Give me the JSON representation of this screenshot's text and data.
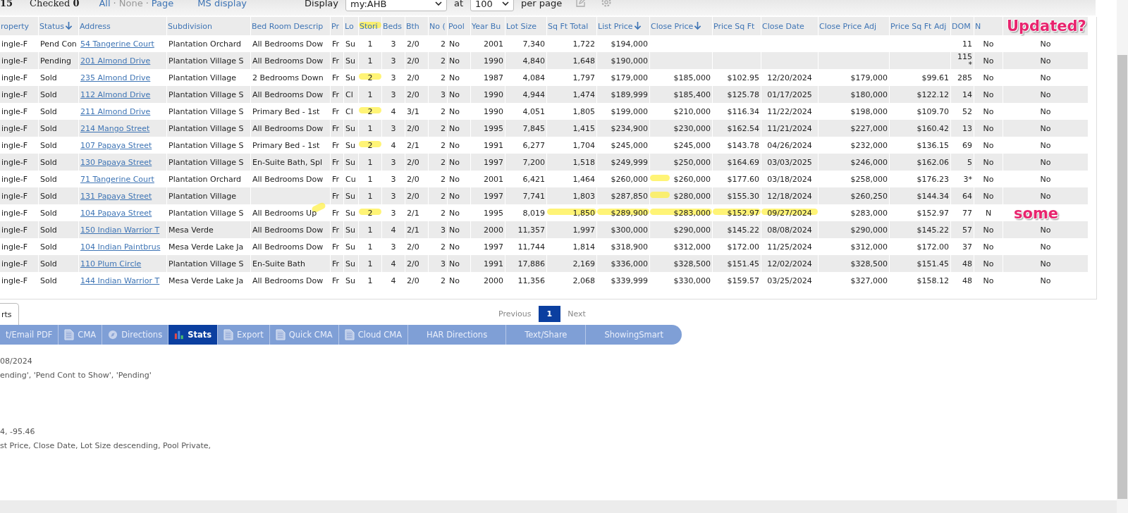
{
  "topbar": {
    "count": "15",
    "checked": "Checked **0**",
    "select_links": [
      {
        "label": "All",
        "kind": "link",
        "disabled": false
      },
      {
        "label": "·",
        "kind": "separator"
      },
      {
        "label": "None",
        "kind": "link",
        "disabled": true
      },
      {
        "label": "·",
        "kind": "separator"
      },
      {
        "label": "Page",
        "kind": "link",
        "disabled": false
      }
    ],
    "ms_display": "MS display",
    "display_label": "Display",
    "display_value": "my:AHB",
    "at_label": "at",
    "per_page_value": "100",
    "per_page_label": "per page"
  },
  "columns": [
    {
      "label": "roperty",
      "sorted": false
    },
    {
      "label": "Status",
      "sorted": true
    },
    {
      "label": "Address",
      "sorted": false,
      "kind": "link"
    },
    {
      "label": "Subdivision",
      "sorted": false
    },
    {
      "label": "Bed Room Descrip",
      "sorted": false
    },
    {
      "label": "Pr",
      "sorted": false
    },
    {
      "label": "Lo",
      "sorted": false
    },
    {
      "label": "Stori",
      "sorted": false,
      "highlighted": true
    },
    {
      "label": "Beds",
      "sorted": false
    },
    {
      "label": "Bth",
      "sorted": false
    },
    {
      "label": "No (",
      "sorted": false
    },
    {
      "label": "Pool",
      "sorted": false
    },
    {
      "label": "Year Bu",
      "sorted": false
    },
    {
      "label": "Lot Size",
      "sorted": false
    },
    {
      "label": "Sq Ft Total",
      "sorted": false
    },
    {
      "label": "List Price",
      "sorted": true
    },
    {
      "label": "Close Price",
      "sorted": true
    },
    {
      "label": "Price Sq Ft",
      "sorted": false
    },
    {
      "label": "Close Date",
      "sorted": false
    },
    {
      "label": "Close Price Adj",
      "sorted": false
    },
    {
      "label": "Price Sq Ft Adj",
      "sorted": false
    },
    {
      "label": "DOM",
      "sorted": false
    },
    {
      "label": "N",
      "sorted": false
    }
  ],
  "rows": [
    {
      "kind": "plain",
      "cells": [
        "ingle-F",
        "Pend Con",
        "54 Tangerine Court",
        "Plantation Orchard",
        "All Bedrooms Dow",
        "Fr",
        "Su",
        "1",
        "3",
        "2/0",
        "2",
        "No",
        "2001",
        "7,340",
        "1,722",
        "$194,000",
        null,
        null,
        null,
        null,
        null,
        "11",
        "No",
        "No"
      ]
    },
    {
      "kind": "plain",
      "cells": [
        "ingle-F",
        "Pending",
        "201 Almond Drive",
        "Plantation Village S",
        "All Bedrooms Dow",
        "Fr",
        "Su",
        "1",
        "3",
        "2/0",
        "2",
        "No",
        "1990",
        "4,840",
        "1,648",
        "$190,000",
        null,
        null,
        null,
        null,
        null,
        "115\n*",
        "No",
        "No"
      ]
    },
    {
      "kind": "stories-marked",
      "cells": [
        "ingle-F",
        "Sold",
        "235 Almond Drive",
        "Plantation Village",
        "2 Bedrooms Down",
        "Fr",
        "Su",
        "2",
        "3",
        "2/0",
        "2",
        "No",
        "1987",
        "4,084",
        "1,797",
        "$179,000",
        "$185,000",
        "$102.95",
        "12/20/2024",
        "$179,000",
        "$99.61",
        "285",
        "No",
        "No"
      ]
    },
    {
      "kind": "plain",
      "cells": [
        "ingle-F",
        "Sold",
        "112 Almond Drive",
        "Plantation Village S",
        "All Bedrooms Dow",
        "Fr",
        "Cl",
        "1",
        "3",
        "2/0",
        "3",
        "No",
        "1990",
        "4,944",
        "1,474",
        "$189,999",
        "$185,400",
        "$125.78",
        "01/17/2025",
        "$180,000",
        "$122.12",
        "14",
        "No",
        "No"
      ]
    },
    {
      "kind": "stories-marked",
      "cells": [
        "ingle-F",
        "Sold",
        "211 Almond Drive",
        "Plantation Village S",
        "Primary Bed - 1st",
        "Fr",
        "Cl",
        "2",
        "4",
        "3/1",
        "2",
        "No",
        "1990",
        "4,051",
        "1,805",
        "$199,000",
        "$210,000",
        "$116.34",
        "11/22/2024",
        "$198,000",
        "$109.70",
        "52",
        "No",
        "No"
      ]
    },
    {
      "kind": "plain",
      "cells": [
        "ingle-F",
        "Sold",
        "214 Mango Street",
        "Plantation Village S",
        "All Bedrooms Dow",
        "Fr",
        "Su",
        "1",
        "3",
        "2/0",
        "2",
        "No",
        "1995",
        "7,845",
        "1,415",
        "$234,900",
        "$230,000",
        "$162.54",
        "11/21/2024",
        "$227,000",
        "$160.42",
        "13",
        "No",
        "No"
      ]
    },
    {
      "kind": "stories-marked",
      "cells": [
        "ingle-F",
        "Sold",
        "107 Papaya Street",
        "Plantation Village S",
        "Primary Bed - 1st",
        "Fr",
        "Su",
        "2",
        "4",
        "2/1",
        "2",
        "No",
        "1991",
        "6,277",
        "1,704",
        "$245,000",
        "$245,000",
        "$143.78",
        "04/26/2024",
        "$232,000",
        "$136.15",
        "69",
        "No",
        "No"
      ]
    },
    {
      "kind": "plain",
      "cells": [
        "ingle-F",
        "Sold",
        "130 Papaya Street",
        "Plantation Village S",
        "En-Suite Bath, Spl",
        "Fr",
        "Su",
        "1",
        "3",
        "2/0",
        "2",
        "No",
        "1997",
        "7,200",
        "1,518",
        "$249,999",
        "$250,000",
        "$164.69",
        "03/03/2025",
        "$246,000",
        "$162.06",
        "5",
        "No",
        "No"
      ]
    },
    {
      "kind": "close-price-marked",
      "cells": [
        "ingle-F",
        "Sold",
        "71 Tangerine Court",
        "Plantation Orchard",
        "All Bedrooms Dow",
        "Fr",
        "Cu",
        "1",
        "3",
        "2/0",
        "2",
        "No",
        "2001",
        "6,421",
        "1,464",
        "$260,000",
        "$260,000",
        "$177.60",
        "03/18/2024",
        "$258,000",
        "$176.23",
        "3*",
        "No",
        "No"
      ]
    },
    {
      "kind": "close-price-marked",
      "cells": [
        "ingle-F",
        "Sold",
        "131 Papaya Street",
        "Plantation Village",
        null,
        "Fr",
        "Su",
        "1",
        "3",
        "2/0",
        "2",
        "No",
        "1997",
        "7,741",
        "1,803",
        "$287,850",
        "$280,000",
        "$155.30",
        "12/18/2024",
        "$260,250",
        "$144.34",
        "64",
        "No",
        "No"
      ]
    },
    {
      "kind": "line-marked",
      "cells": [
        "ingle-F",
        "Sold",
        "104 Papaya Street",
        "Plantation Village S",
        "All Bedrooms Up",
        "Fr",
        "Su",
        "2",
        "3",
        "2/1",
        "2",
        "No",
        "1995",
        "8,019",
        "1,850",
        "$289,900",
        "$283,000",
        "$152.97",
        "09/27/2024",
        "$283,000",
        "$152.97",
        "77",
        "N"
      ]
    },
    {
      "kind": "plain",
      "cells": [
        "ingle-F",
        "Sold",
        "150 Indian Warrior T",
        "Mesa Verde",
        "All Bedrooms Dow",
        "Fr",
        "Su",
        "1",
        "4",
        "2/1",
        "3",
        "No",
        "2000",
        "11,357",
        "1,997",
        "$300,000",
        "$290,000",
        "$145.22",
        "08/08/2024",
        "$290,000",
        "$145.22",
        "57",
        "No",
        "No"
      ]
    },
    {
      "kind": "plain",
      "cells": [
        "ingle-F",
        "Sold",
        "104 Indian Paintbrus",
        "Mesa Verde Lake Ja",
        "All Bedrooms Dow",
        "Fr",
        "Su",
        "1",
        "3",
        "2/0",
        "2",
        "No",
        "1997",
        "11,744",
        "1,814",
        "$318,900",
        "$312,000",
        "$172.00",
        "11/25/2024",
        "$312,000",
        "$172.00",
        "37",
        "No",
        "No"
      ]
    },
    {
      "kind": "plain",
      "cells": [
        "ingle-F",
        "Sold",
        "110 Plum Circle",
        "Plantation Village S",
        "En-Suite Bath",
        "Fr",
        "Su",
        "1",
        "4",
        "2/0",
        "3",
        "No",
        "1991",
        "17,886",
        "2,169",
        "$336,000",
        "$328,500",
        "$151.45",
        "12/02/2024",
        "$328,500",
        "$151.45",
        "48",
        "No",
        "No"
      ]
    },
    {
      "kind": "plain",
      "cells": [
        "ingle-F",
        "Sold",
        "144 Indian Warrior T",
        "Mesa Verde Lake Ja",
        "All Bedrooms Dow",
        "Fr",
        "Su",
        "1",
        "4",
        "2/0",
        "2",
        "No",
        "2000",
        "11,356",
        "2,068",
        "$339,999",
        "$330,000",
        "$159.57",
        "03/25/2024",
        "$327,000",
        "$158.12",
        "48",
        "No",
        "No"
      ]
    }
  ],
  "annotations": [
    {
      "text": "Updated?"
    },
    {
      "text": "some"
    }
  ],
  "tab": {
    "label": "rts",
    "selected": true
  },
  "pagination": {
    "previous": "Previous",
    "pages": [
      {
        "label": "1",
        "selected": true
      }
    ],
    "next": "Next"
  },
  "toolbar": [
    {
      "label": "t/Email PDF",
      "kind": "plain",
      "selected": false
    },
    {
      "label": "CMA",
      "kind": "document",
      "selected": false
    },
    {
      "label": "Directions",
      "kind": "compass",
      "selected": false
    },
    {
      "label": "Stats",
      "kind": "chart",
      "selected": true
    },
    {
      "label": "Export",
      "kind": "document",
      "selected": false
    },
    {
      "label": "Quick CMA",
      "kind": "document",
      "selected": false
    },
    {
      "label": "Cloud CMA",
      "kind": "document",
      "selected": false
    },
    {
      "label": "HAR Directions",
      "kind": "plain",
      "selected": false
    },
    {
      "label": "Text/Share",
      "kind": "plain",
      "selected": false
    },
    {
      "label": "ShowingSmart",
      "kind": "plain",
      "selected": false
    }
  ],
  "info_lines": [
    "08/2024",
    "ending', 'Pend Cont to Show', 'Pending'",
    "4, -95.46",
    "st Price, Close Date, Lot Size descending, Pool Private,"
  ]
}
